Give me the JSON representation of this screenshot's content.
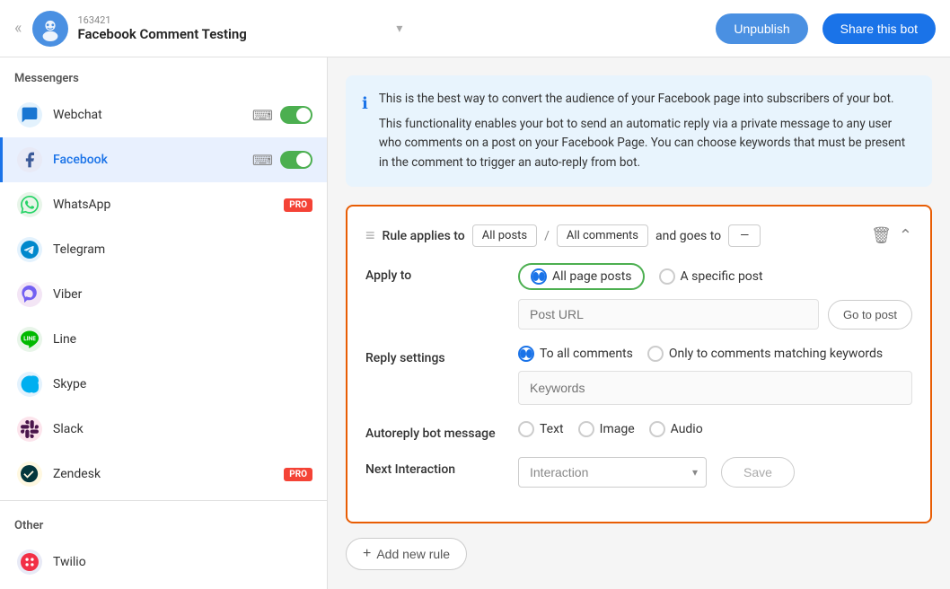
{
  "header": {
    "bot_id": "163421",
    "bot_name": "Facebook Comment Testing",
    "unpublish_label": "Unpublish",
    "share_label": "Share this bot"
  },
  "sidebar": {
    "section_messengers": "Messengers",
    "section_other": "Other",
    "items": [
      {
        "id": "webchat",
        "label": "Webchat",
        "icon": "💬",
        "color": "webchat",
        "has_toggle": true,
        "toggle_on": true,
        "active": false
      },
      {
        "id": "facebook",
        "label": "Facebook",
        "icon": "f",
        "color": "facebook",
        "has_toggle": true,
        "toggle_on": true,
        "active": true
      },
      {
        "id": "whatsapp",
        "label": "WhatsApp",
        "icon": "📱",
        "color": "whatsapp",
        "has_toggle": false,
        "pro": true,
        "active": false
      },
      {
        "id": "telegram",
        "label": "Telegram",
        "icon": "✈",
        "color": "telegram",
        "has_toggle": false,
        "active": false
      },
      {
        "id": "viber",
        "label": "Viber",
        "icon": "📞",
        "color": "viber",
        "has_toggle": false,
        "active": false
      },
      {
        "id": "line",
        "label": "Line",
        "icon": "L",
        "color": "line",
        "has_toggle": false,
        "active": false
      },
      {
        "id": "skype",
        "label": "Skype",
        "icon": "S",
        "color": "skype",
        "has_toggle": false,
        "active": false
      },
      {
        "id": "slack",
        "label": "Slack",
        "icon": "#",
        "color": "slack",
        "has_toggle": false,
        "active": false
      },
      {
        "id": "zendesk",
        "label": "Zendesk",
        "icon": "Z",
        "color": "zendesk",
        "has_toggle": false,
        "pro": true,
        "active": false
      }
    ],
    "other_items": [
      {
        "id": "twilio",
        "label": "Twilio",
        "icon": "T",
        "color": "twilio",
        "has_toggle": false,
        "active": false
      }
    ]
  },
  "info": {
    "line1": "This is the best way to convert the audience of your Facebook page into subscribers of your bot.",
    "line2": "This functionality enables your bot to send an automatic reply via a private message to any user who comments on a post on your Facebook Page. You can choose keywords that must be present in the comment to trigger an auto-reply from bot."
  },
  "rule": {
    "applies_to_label": "Rule applies to",
    "all_posts_label": "All posts",
    "slash": "/",
    "all_comments_label": "All comments",
    "and_goes_to": "and goes to",
    "dash": "—",
    "apply_to_label": "Apply to",
    "all_page_posts": "All page posts",
    "a_specific_post": "A specific post",
    "post_url_placeholder": "Post URL",
    "go_to_post_label": "Go to post",
    "reply_settings_label": "Reply settings",
    "to_all_comments": "To all comments",
    "only_matching": "Only to comments matching keywords",
    "keywords_placeholder": "Keywords",
    "autoreply_label": "Autoreply bot message",
    "text_label": "Text",
    "image_label": "Image",
    "audio_label": "Audio",
    "next_interaction_label": "Next Interaction",
    "interaction_placeholder": "Interaction",
    "save_label": "Save",
    "add_rule_label": "Add new rule"
  }
}
